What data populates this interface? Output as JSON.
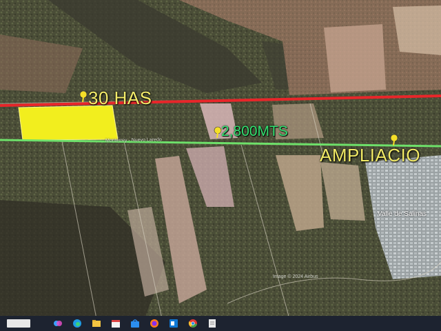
{
  "labels": {
    "area": "30 HAS",
    "distance": "2,800MTS",
    "expansion": "AMPLIACIO",
    "road": "Monterrey - Nuevo Laredo",
    "town": "Valle de Salinas",
    "credit": "Image © 2024 Airbus"
  },
  "colors": {
    "red_line": "#e8262a",
    "green_line": "#6ee06a",
    "parcel": "#f2ee1e",
    "pin": "#f5df28"
  },
  "icons": [
    "pin-icon",
    "pin-icon",
    "pin-icon"
  ],
  "taskbar": {
    "icons": [
      "copilot-icon",
      "edge-icon",
      "file-explorer-icon",
      "calendar-icon",
      "store-icon",
      "firefox-icon",
      "outlook-icon",
      "chrome-icon",
      "notepad-icon"
    ]
  }
}
